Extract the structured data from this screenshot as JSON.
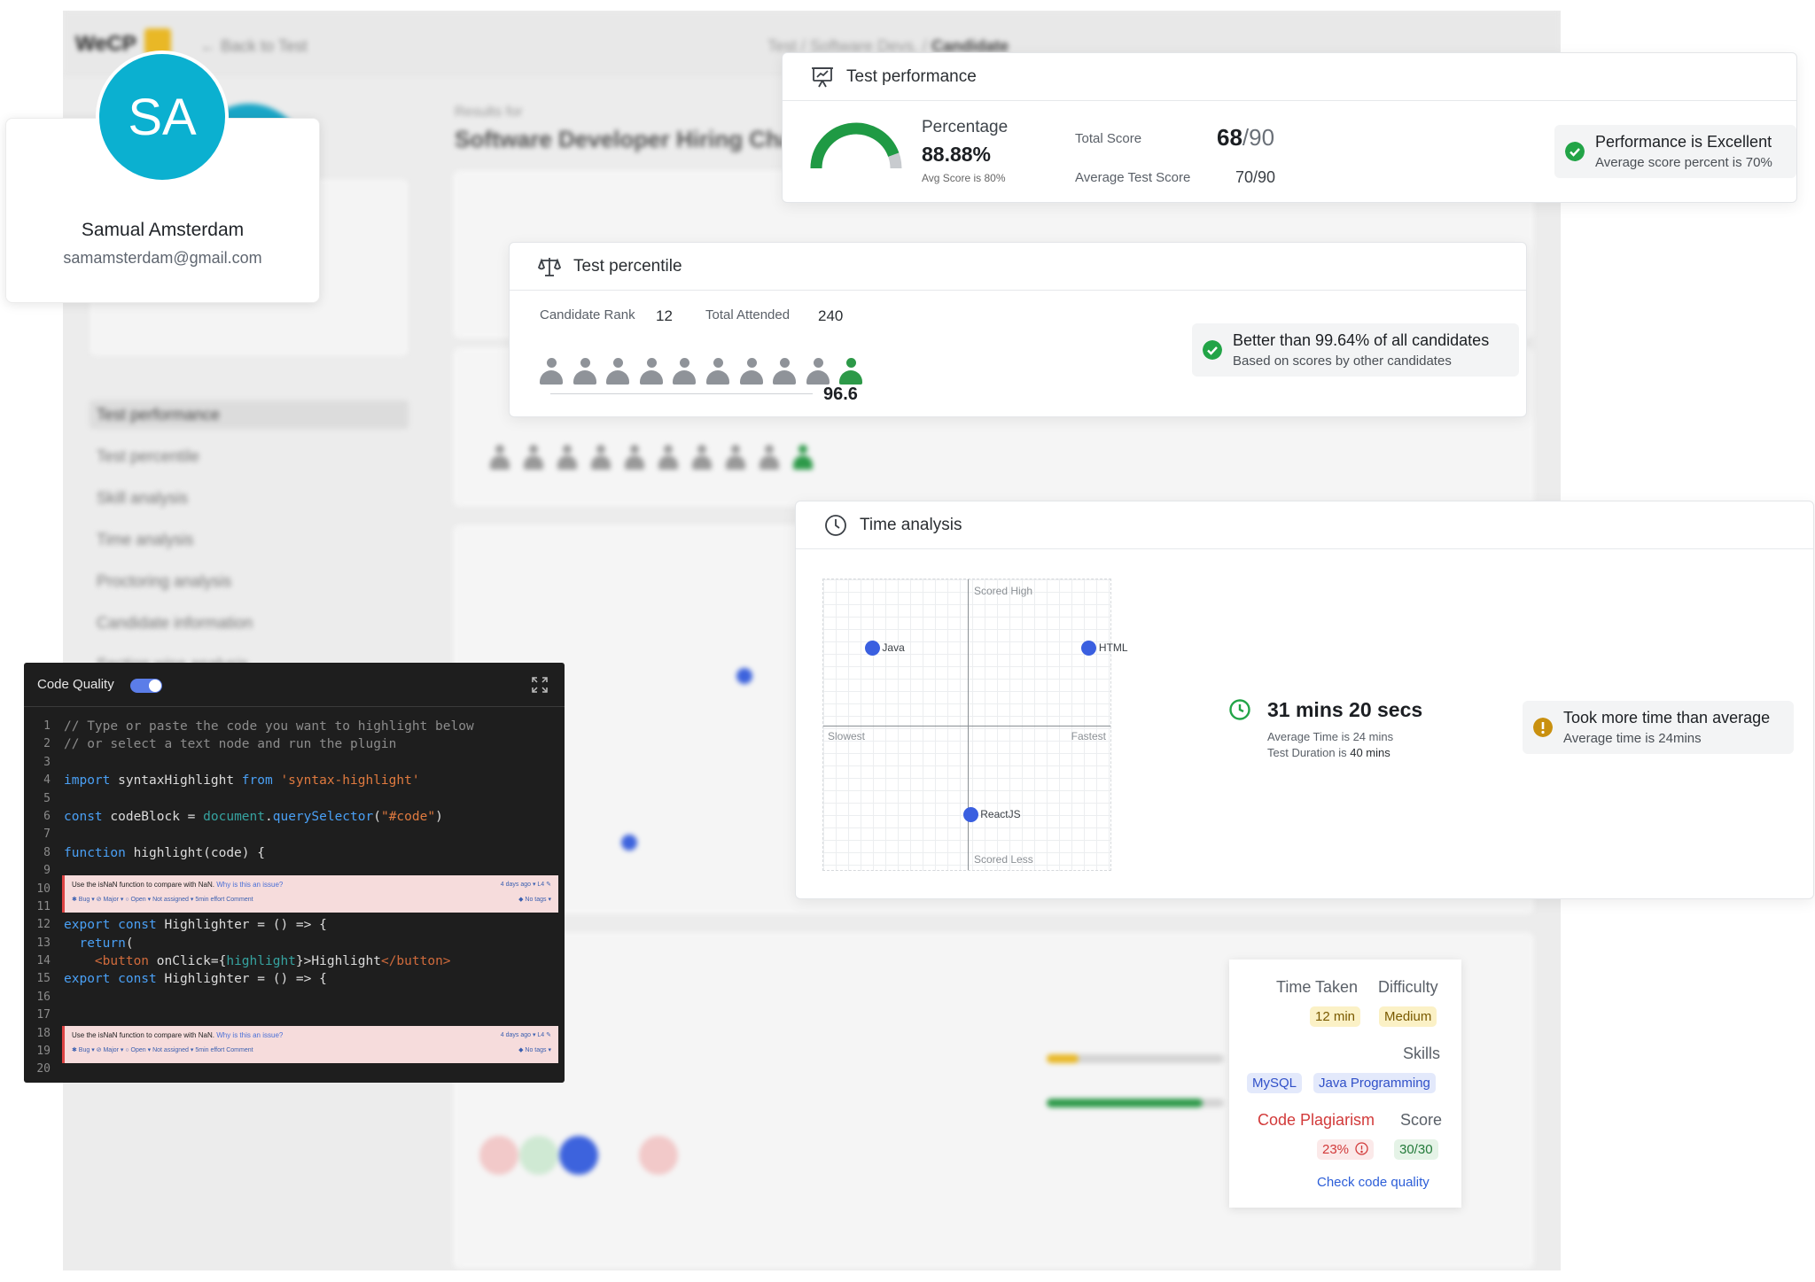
{
  "background_app": {
    "logo": "WeCP",
    "back_link": "Back to Test",
    "breadcrumb_path": "Test / Software Devs. /",
    "breadcrumb_current": "Candidate",
    "results_for": "Results for",
    "test_title": "Software Developer Hiring Challenge",
    "nav": [
      "Test performance",
      "Test percentile",
      "Skill analysis",
      "Time analysis",
      "Proctoring analysis",
      "Candidate information",
      "Section wise analysis"
    ]
  },
  "profile": {
    "initials": "SA",
    "name": "Samual Amsterdam",
    "email": "samamsterdam@gmail.com"
  },
  "test_performance": {
    "title": "Test performance",
    "percentage_label": "Percentage",
    "percentage_value": "88.88%",
    "percentage_fraction": 0.8888,
    "avg_score_note": "Avg Score is 80%",
    "total_score_label": "Total Score",
    "total_score_value": "68",
    "total_score_max": "/90",
    "avg_test_score_label": "Average Test Score",
    "avg_test_score_value": "70/90",
    "status_title": "Performance is Excellent",
    "status_sub": "Average score percent is 70%",
    "colors": {
      "gauge_fill": "#1f9a44",
      "gauge_track": "#c8cbcf",
      "success": "#22a447"
    }
  },
  "test_percentile": {
    "title": "Test percentile",
    "rank_label": "Candidate Rank",
    "rank_value": "12",
    "attended_label": "Total Attended",
    "attended_value": "240",
    "score": "96.6",
    "people_total": 10,
    "people_highlighted_index": 9,
    "status_title": "Better than 99.64% of all candidates",
    "status_sub": "Based on scores by other candidates"
  },
  "time_analysis": {
    "title": "Time analysis",
    "axis_top": "Scored High",
    "axis_bottom": "Scored Less",
    "axis_left": "Slowest",
    "axis_right": "Fastest",
    "points": [
      {
        "name": "Java",
        "speed": -0.66,
        "score": 0.53
      },
      {
        "name": "HTML",
        "speed": 0.84,
        "score": 0.53
      },
      {
        "name": "ReactJS",
        "speed": 0.02,
        "score": -0.61
      }
    ],
    "time_taken": "31 mins 20 secs",
    "avg_time_note": "Average Time is 24 mins",
    "duration_label": "Test Duration is",
    "duration_value": "40 mins",
    "status_title": "Took more time than average",
    "status_sub": "Average time is 24mins",
    "colors": {
      "point": "#3a5fe0",
      "warning": "#c9900f",
      "clock": "#22a447"
    }
  },
  "code_quality": {
    "title": "Code Quality",
    "toggle_on": true,
    "lines": {
      "l1": "// Type or paste the code you want to highlight below",
      "l2": "// or select a text node and run the plugin",
      "l4_kw": "import",
      "l4_id": " syntaxHighlight ",
      "l4_from": "from",
      "l4_str": " 'syntax-highlight'",
      "l6_kw": "const",
      "l6_id": " codeBlock = ",
      "l6_doc": "document",
      "l6_dot": ".",
      "l6_fn": "querySelector",
      "l6_open": "(",
      "l6_str": "\"#code\"",
      "l6_close": ")",
      "l8_kw": "function",
      "l8_rest": " highlight(code) {",
      "l12_kw": "export const",
      "l12_rest": " Highlighter = () => {",
      "l13_kw": "  return",
      "l13_rest": "(",
      "l14_tag": "    <button",
      "l14_attr": " onClick={",
      "l14_var": "highlight",
      "l14_close": "}>",
      "l14_text": "Highlight",
      "l14_end": "</button>",
      "l15_kw": "export const",
      "l15_rest": " Highlighter = () => {"
    },
    "line_numbers": [
      "1",
      "2",
      "3",
      "4",
      "5",
      "6",
      "7",
      "8",
      "9",
      "10",
      "11",
      "12",
      "13",
      "14",
      "15",
      "16",
      "17",
      "18",
      "19",
      "20"
    ],
    "issue": {
      "message": "Use the isNaN function to compare with NaN.",
      "why": "Why is this an issue?",
      "ago": "4 days ago ▾   L4   ✎",
      "meta": "✱ Bug ▾    ⊘ Major ▾    ○ Open ▾    Not assigned ▾    5min effort    Comment",
      "tags": "◆ No tags ▾"
    }
  },
  "question_detail": {
    "time_taken_label": "Time Taken",
    "time_taken_value": "12 min",
    "difficulty_label": "Difficulty",
    "difficulty_value": "Medium",
    "skills_label": "Skills",
    "skills": [
      "MySQL",
      "Java Programming"
    ],
    "plagiarism_label": "Code Plagiarism",
    "plagiarism_value": "23%",
    "score_label": "Score",
    "score_value": "30/30",
    "link": "Check code quality",
    "colors": {
      "plagiarism": "#d23a3a",
      "link": "#2c5ed8"
    }
  }
}
